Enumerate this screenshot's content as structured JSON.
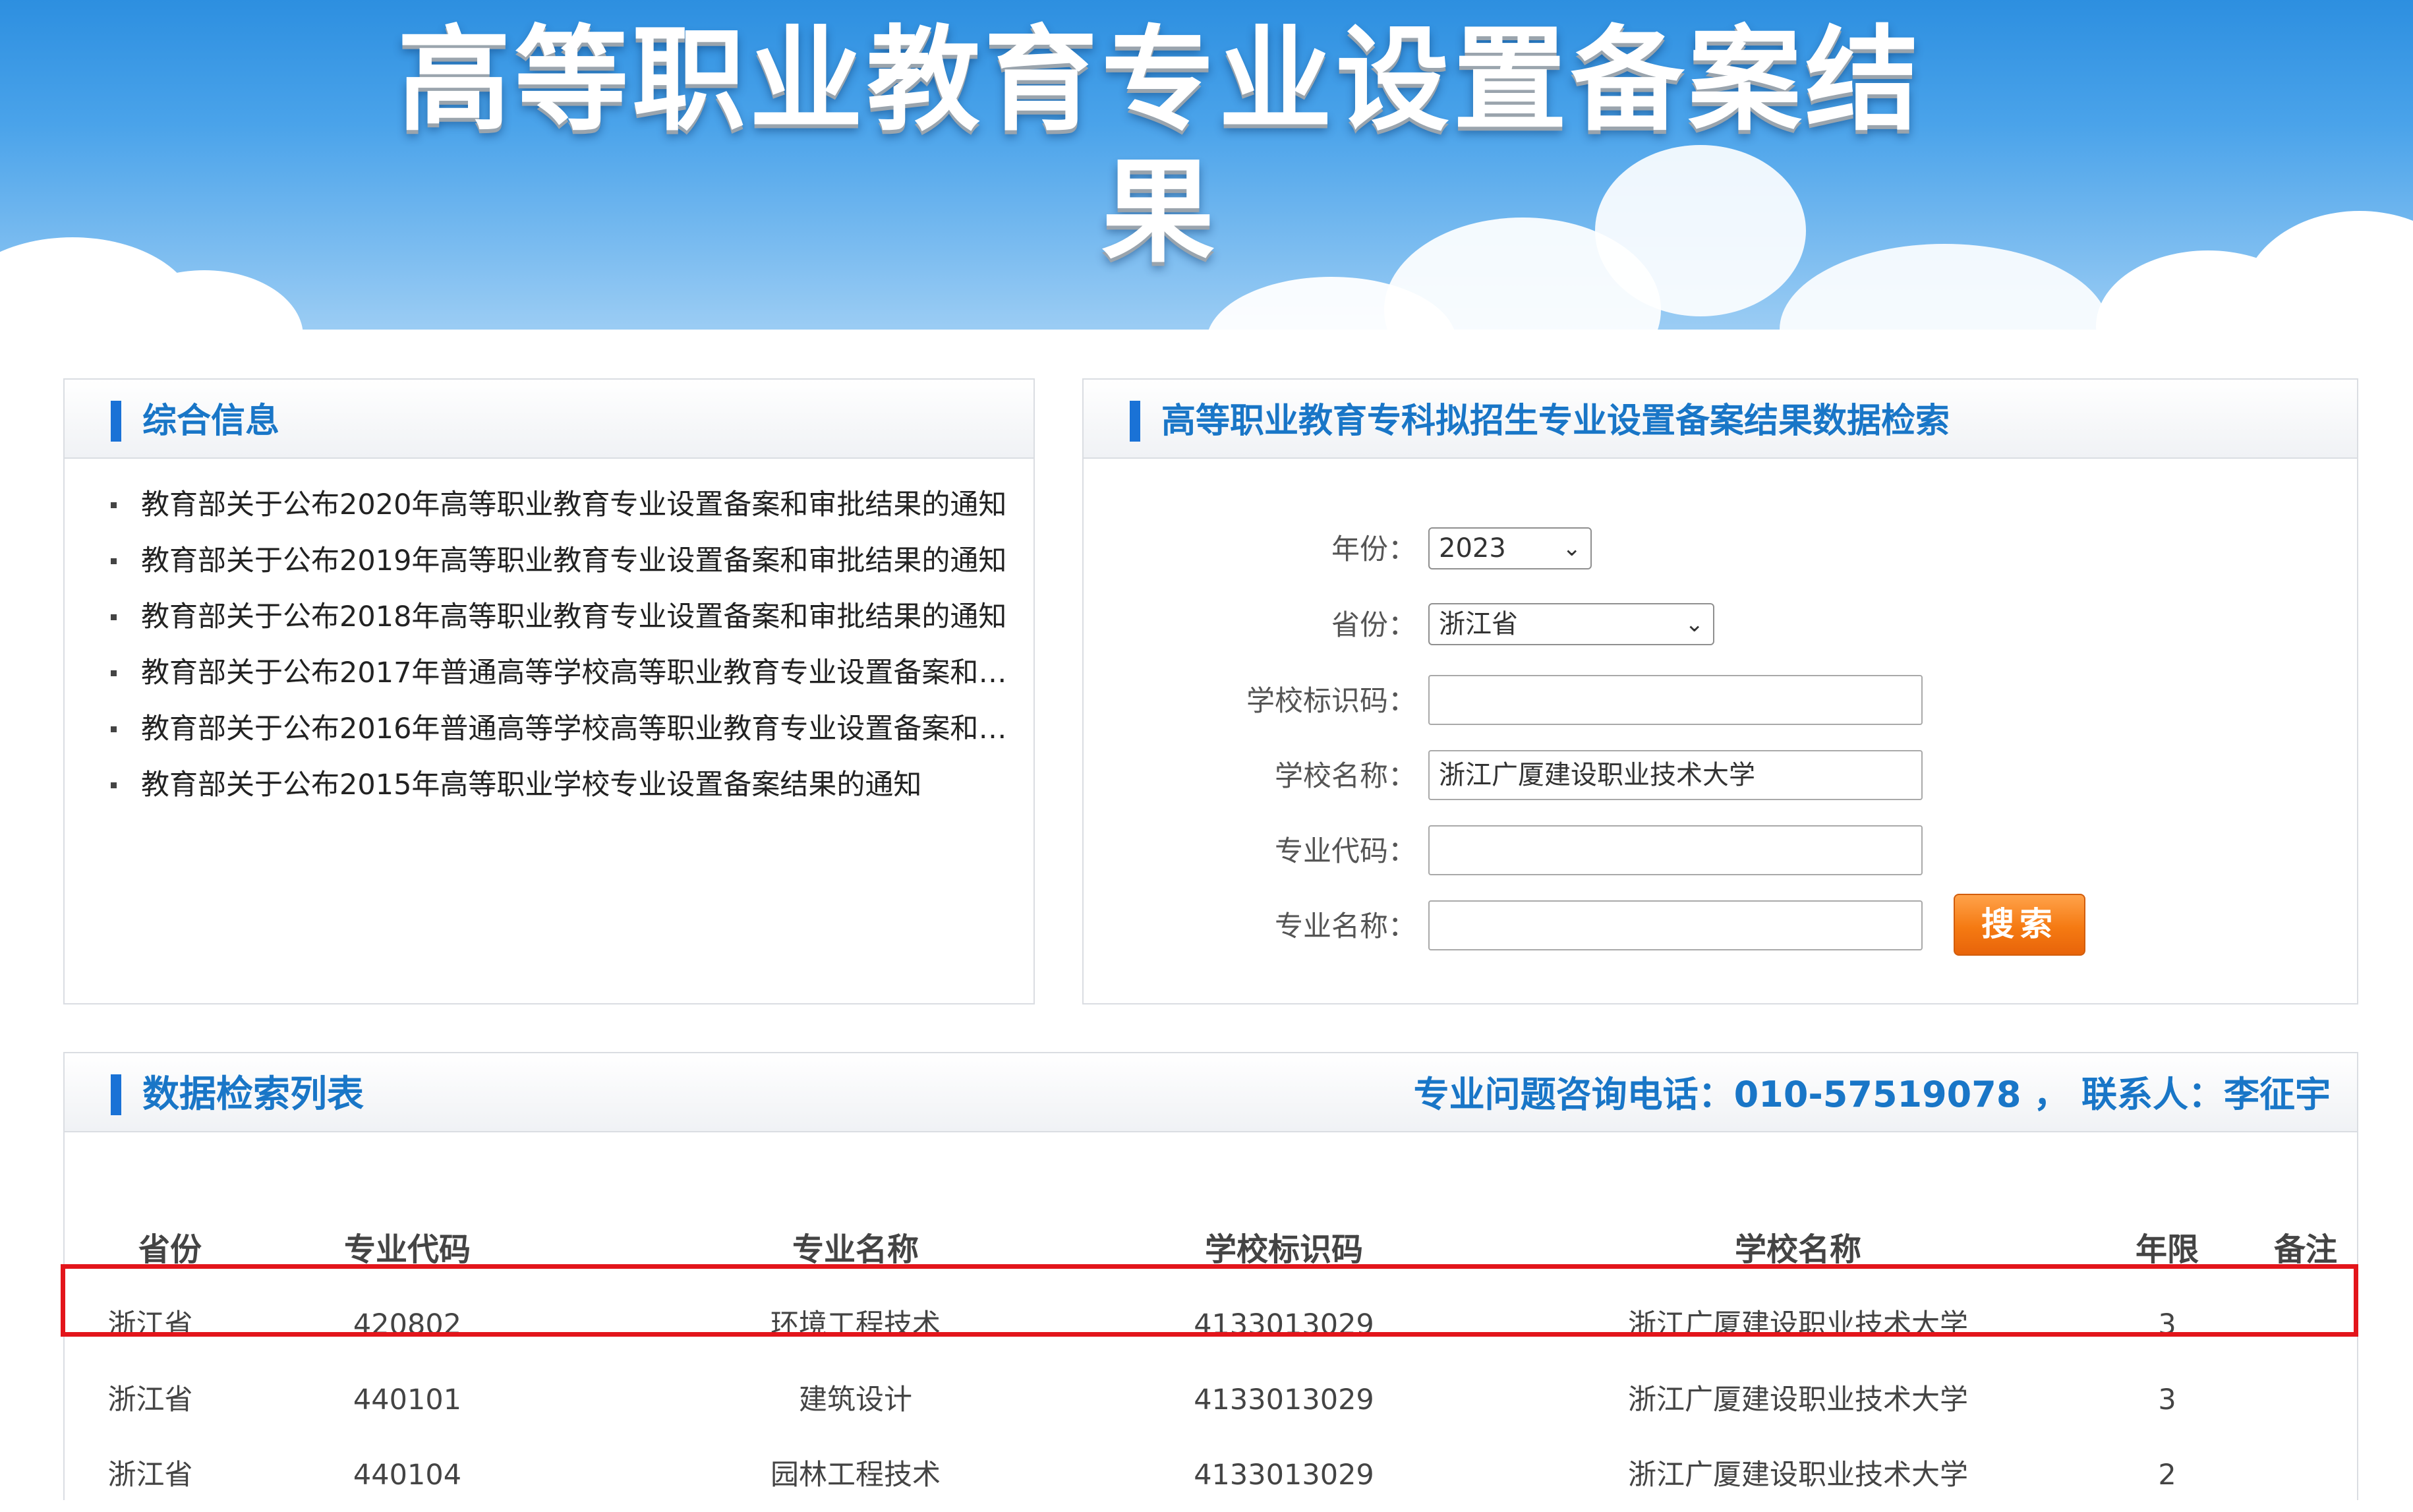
{
  "banner": {
    "title": "高等职业教育专业设置备案结果"
  },
  "info_panel": {
    "title": "综合信息",
    "items": [
      "教育部关于公布2020年高等职业教育专业设置备案和审批结果的通知",
      "教育部关于公布2019年高等职业教育专业设置备案和审批结果的通知",
      "教育部关于公布2018年高等职业教育专业设置备案和审批结果的通知",
      "教育部关于公布2017年普通高等学校高等职业教育专业设置备案和审…",
      "教育部关于公布2016年普通高等学校高等职业教育专业设置备案和审…",
      "教育部关于公布2015年高等职业学校专业设置备案结果的通知"
    ]
  },
  "search_panel": {
    "title": "高等职业教育专科拟招生专业设置备案结果数据检索",
    "year": {
      "label": "年份：",
      "value": "2023"
    },
    "province": {
      "label": "省份：",
      "value": "浙江省"
    },
    "school_code": {
      "label": "学校标识码：",
      "value": ""
    },
    "school_name": {
      "label": "学校名称：",
      "value": "浙江广厦建设职业技术大学"
    },
    "major_code": {
      "label": "专业代码：",
      "value": ""
    },
    "major_name": {
      "label": "专业名称：",
      "value": ""
    },
    "search_button": "搜索"
  },
  "results": {
    "title": "数据检索列表",
    "contact": "专业问题咨询电话：010-57519078 ，  联系人：李征宇",
    "columns": [
      "省份",
      "专业代码",
      "专业名称",
      "学校标识码",
      "学校名称",
      "年限",
      "备注"
    ],
    "rows": [
      [
        "浙江省",
        "420802",
        "环境工程技术",
        "4133013029",
        "浙江广厦建设职业技术大学",
        "3",
        ""
      ],
      [
        "浙江省",
        "440101",
        "建筑设计",
        "4133013029",
        "浙江广厦建设职业技术大学",
        "3",
        ""
      ],
      [
        "浙江省",
        "440104",
        "园林工程技术",
        "4133013029",
        "浙江广厦建设职业技术大学",
        "2",
        ""
      ]
    ],
    "highlighted_row": 0
  },
  "colors": {
    "accent": "#1976c7",
    "button": "#f57a12",
    "highlight": "#e3151b"
  }
}
